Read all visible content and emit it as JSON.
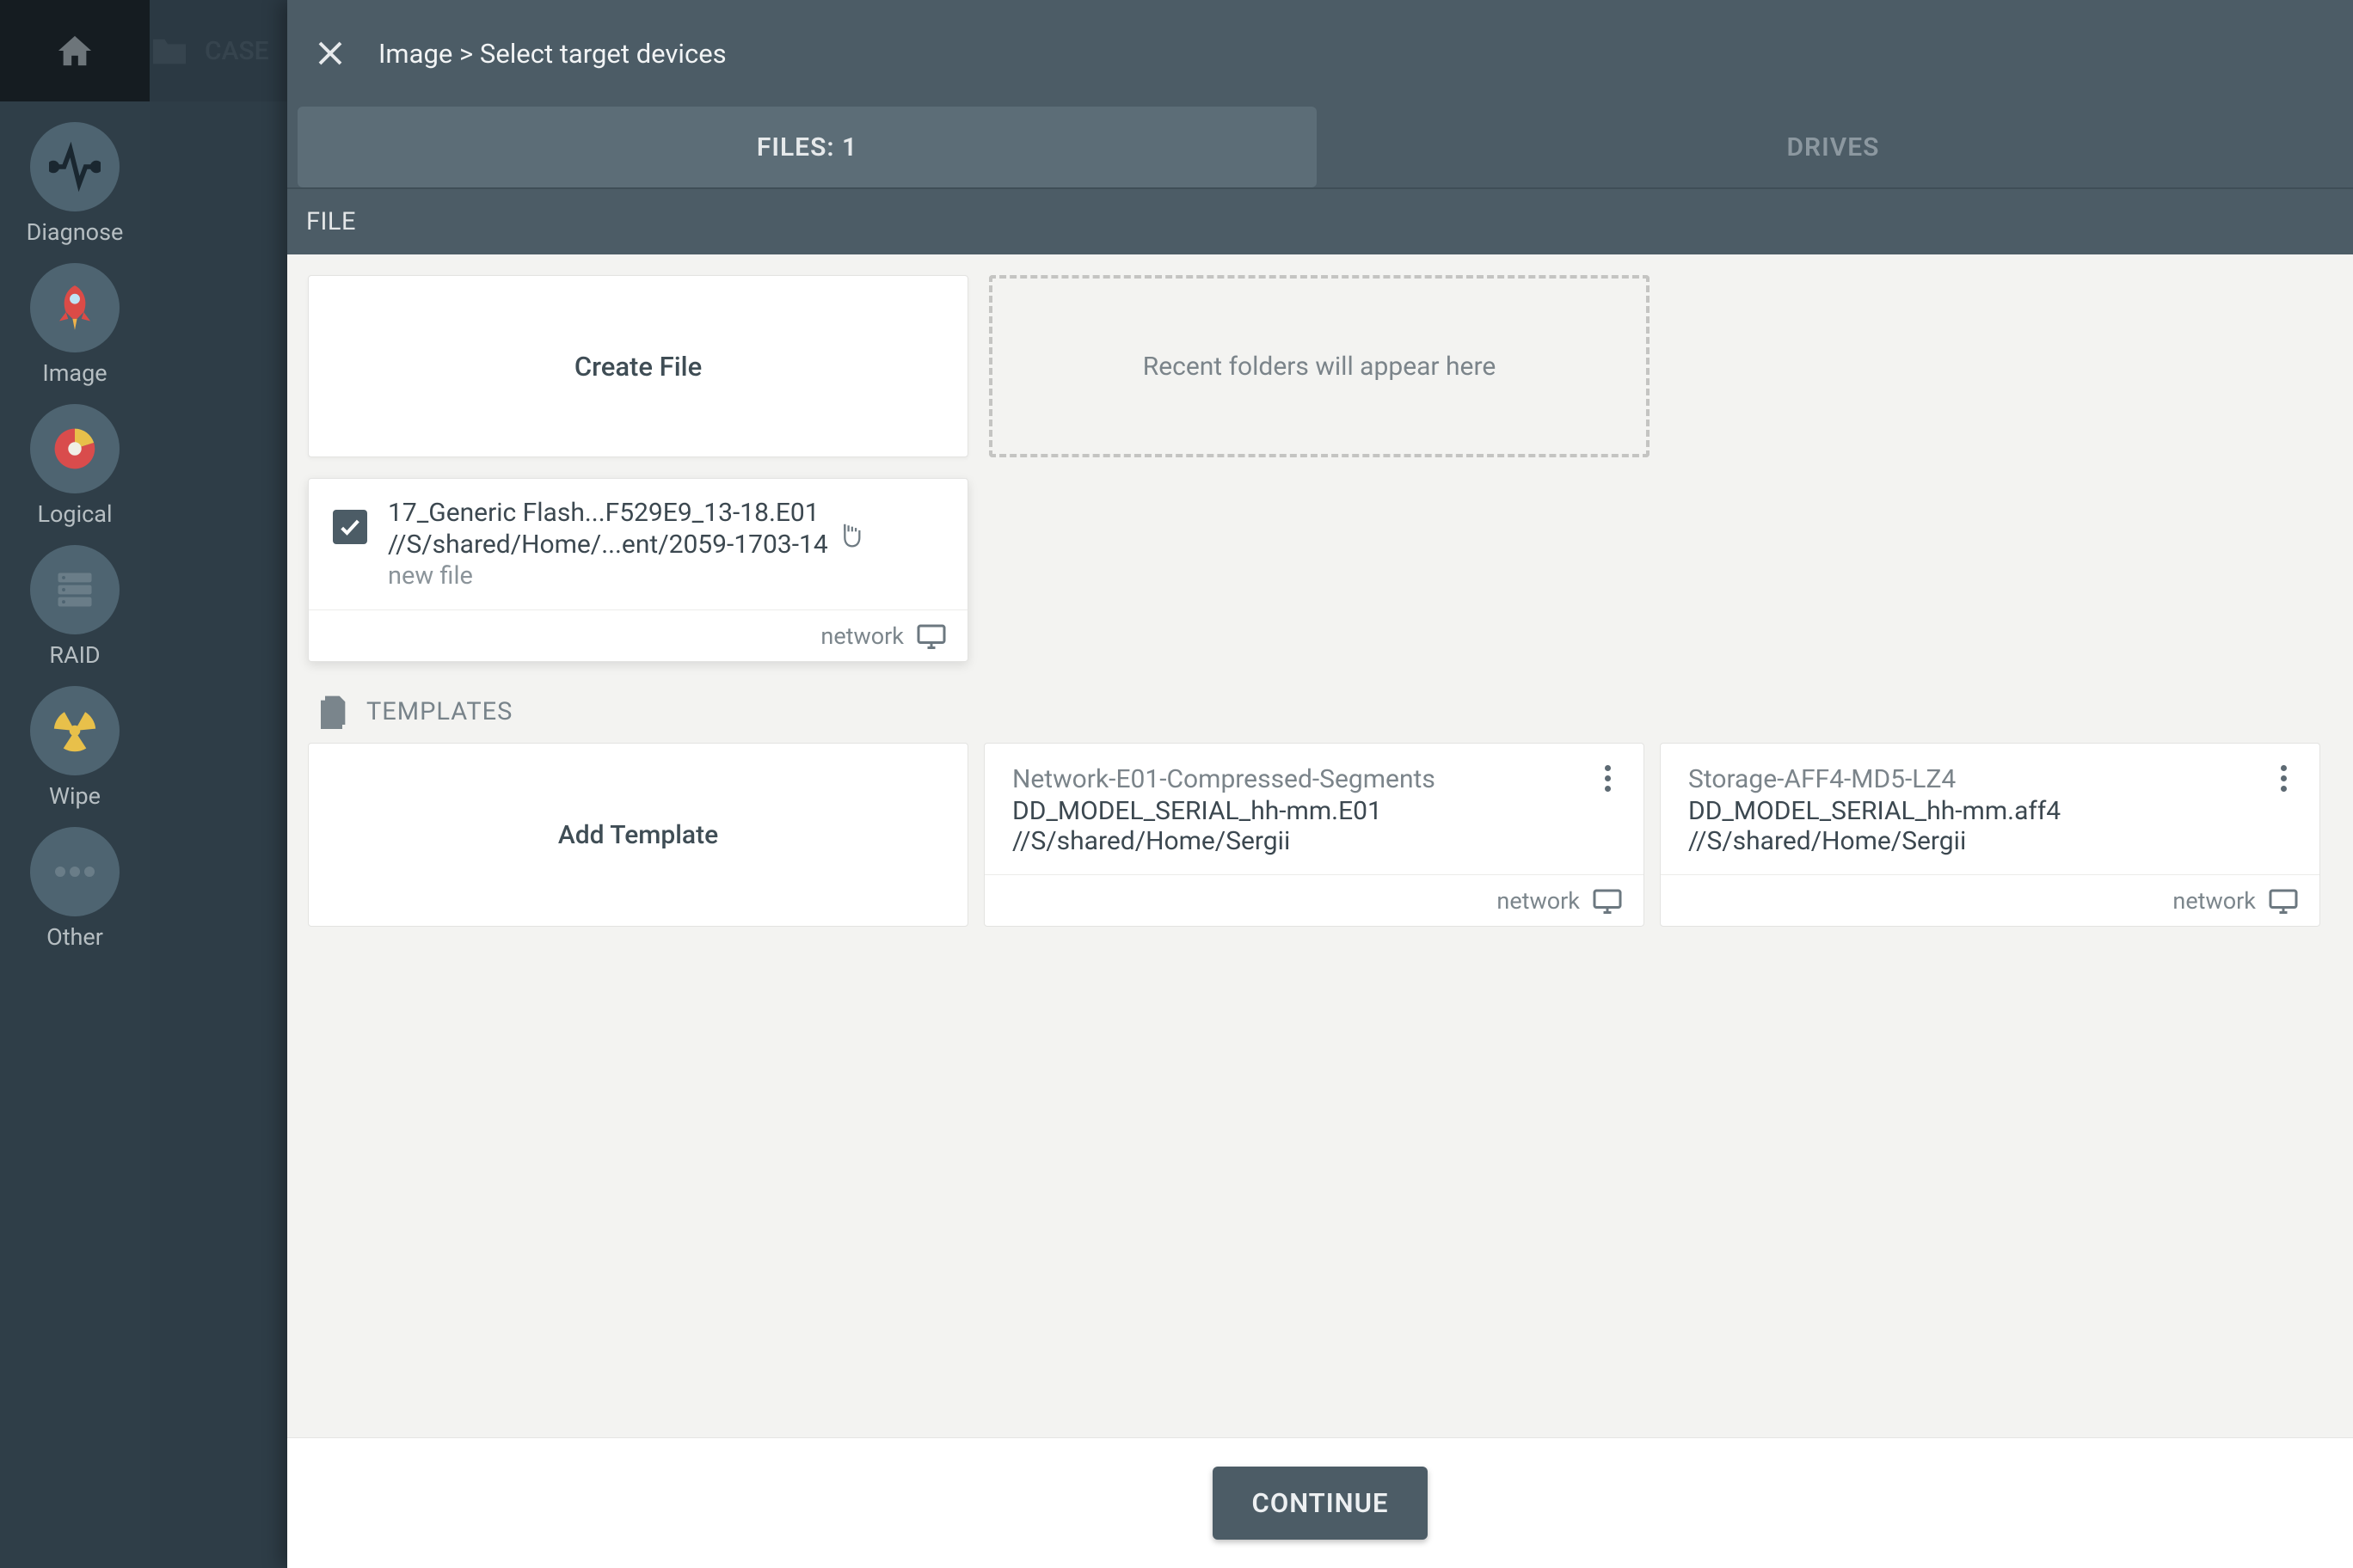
{
  "topbar": {
    "case_label": "CASE"
  },
  "sidebar": {
    "items": [
      {
        "label": "Diagnose"
      },
      {
        "label": "Image"
      },
      {
        "label": "Logical"
      },
      {
        "label": "RAID"
      },
      {
        "label": "Wipe"
      },
      {
        "label": "Other"
      }
    ]
  },
  "dialog": {
    "breadcrumb": "Image > Select target devices",
    "tabs": {
      "files": "FILES: 1",
      "drives": "DRIVES"
    },
    "section_label": "FILE",
    "create_file": "Create File",
    "recent_placeholder": "Recent folders will appear here",
    "selected_file": {
      "name": "17_Generic Flash...F529E9_13-18.E01",
      "path": "//S/shared/Home/...ent/2059-1703-14",
      "status": "new file",
      "location": "network"
    },
    "templates_header": "TEMPLATES",
    "add_template": "Add Template",
    "templates": [
      {
        "title": "Network-E01-Compressed-Segments",
        "filename": "DD_MODEL_SERIAL_hh-mm.E01",
        "path": "//S/shared/Home/Sergii",
        "location": "network"
      },
      {
        "title": "Storage-AFF4-MD5-LZ4",
        "filename": "DD_MODEL_SERIAL_hh-mm.aff4",
        "path": "//S/shared/Home/Sergii",
        "location": "network"
      }
    ],
    "continue": "CONTINUE"
  },
  "colors": {
    "accent": "#4c5c66"
  }
}
